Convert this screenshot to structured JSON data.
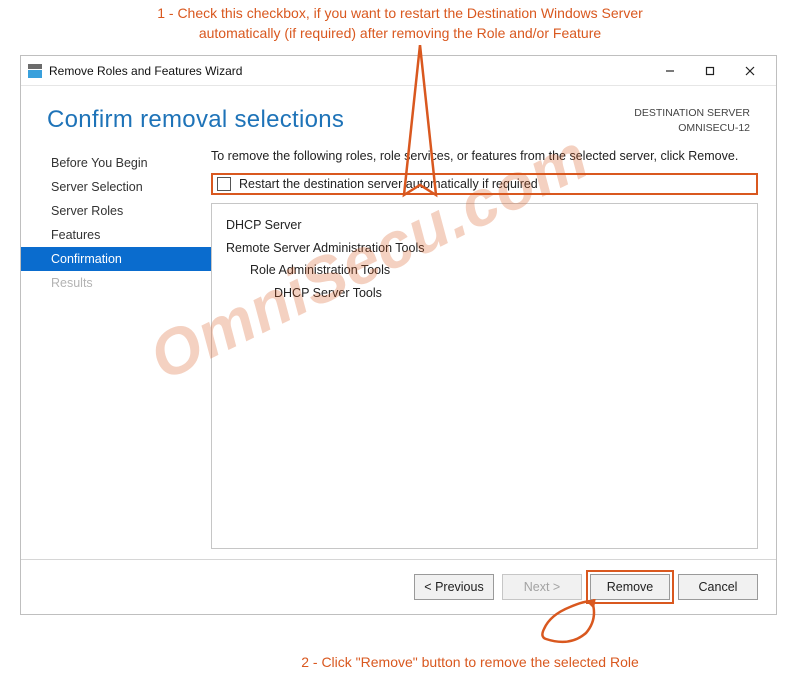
{
  "annotations": {
    "a1": "1 -  Check this checkbox, if you want to restart the Destination Windows Server automatically (if required) after removing the Role and/or Feature",
    "a2": "2 -  Click \"Remove\" button to remove the selected Role"
  },
  "window": {
    "title": "Remove Roles and Features Wizard"
  },
  "page_title": "Confirm removal selections",
  "destination": {
    "label": "DESTINATION SERVER",
    "server": "OMNISECU-12"
  },
  "sidebar": {
    "items": [
      {
        "label": "Before You Begin",
        "state": "normal"
      },
      {
        "label": "Server Selection",
        "state": "normal"
      },
      {
        "label": "Server Roles",
        "state": "normal"
      },
      {
        "label": "Features",
        "state": "normal"
      },
      {
        "label": "Confirmation",
        "state": "active"
      },
      {
        "label": "Results",
        "state": "disabled"
      }
    ]
  },
  "main": {
    "instruction": "To remove the following roles, role services, or features from the selected server, click Remove.",
    "restart_label": "Restart the destination server automatically if required",
    "removal_items": [
      {
        "label": "DHCP Server",
        "indent": 0
      },
      {
        "label": "Remote Server Administration Tools",
        "indent": 0
      },
      {
        "label": "Role Administration Tools",
        "indent": 1
      },
      {
        "label": "DHCP Server Tools",
        "indent": 2
      }
    ]
  },
  "footer": {
    "previous": "< Previous",
    "next": "Next >",
    "remove": "Remove",
    "cancel": "Cancel"
  },
  "watermark": "OmniSecu.com"
}
